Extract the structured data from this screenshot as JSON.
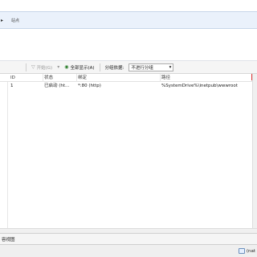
{
  "address": {
    "crumb": "站点",
    "chevron_icon": "chevron-right-icon"
  },
  "toolbar": {
    "start_label": "开始(G)",
    "show_all_label": "全部显示(A)",
    "group_by_label": "分组依据:",
    "group_by_value": "不进行分组",
    "filter_icon": "filter-icon",
    "show_all_icon": "show-all-icon"
  },
  "grid": {
    "columns": [
      "ID",
      "状态",
      "绑定",
      "路径"
    ],
    "rows": [
      {
        "id": "1",
        "status": "已启动 (ht...",
        "binding": "*:80 (http)",
        "path": "%SystemDrive%\\inetpub\\wwwroot"
      }
    ]
  },
  "bottom": {
    "tab_label": "容视图"
  },
  "status": {
    "network_label": "(nat",
    "network_icon": "network-icon"
  }
}
